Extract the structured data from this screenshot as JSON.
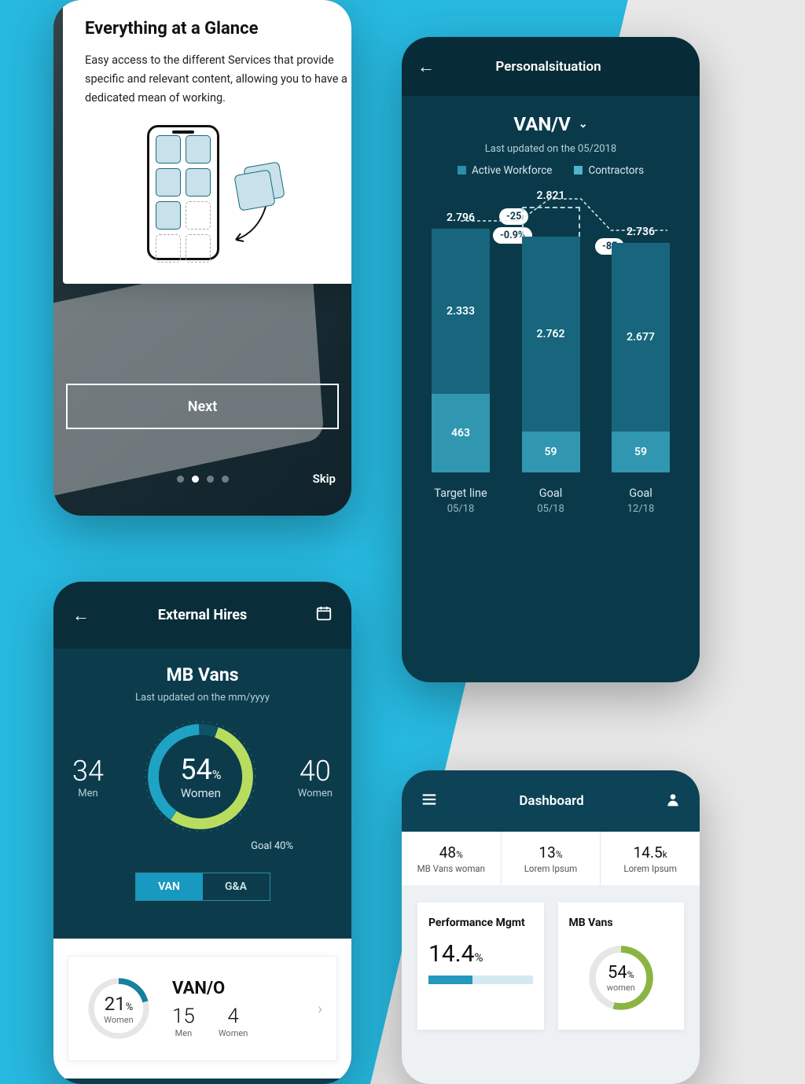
{
  "onboarding": {
    "title": "Everything at a Glance",
    "body": "Easy access to the different Services that provide specific and relevant content, allowing you to have a dedicated mean of working.",
    "next": "Next",
    "skip": "Skip",
    "pagination": {
      "total": 4,
      "active": 1
    }
  },
  "personal": {
    "header": "Personalsituation",
    "dropdown": "VAN/V",
    "updated": "Last updated on the 05/2018",
    "legend": {
      "a": "Active Workforce",
      "b": "Contractors"
    },
    "pills": {
      "diff1": "-25",
      "pct1": "-0.9%",
      "diff2": "-85"
    },
    "chart_data": {
      "type": "bar",
      "stacked": true,
      "series_names": [
        "Contractors",
        "Active Workforce"
      ],
      "columns": [
        {
          "label": "Target line",
          "sublabel": "05/18",
          "total": "2.796",
          "contractors": 463,
          "workforce": "2.333",
          "dashed_cap": false
        },
        {
          "label": "Goal",
          "sublabel": "05/18",
          "total": "2.821",
          "contractors": 59,
          "workforce": "2.762",
          "dashed_cap": true
        },
        {
          "label": "Goal",
          "sublabel": "12/18",
          "total": "2.736",
          "contractors": 59,
          "workforce": "2.677",
          "dashed_cap": false
        }
      ]
    }
  },
  "hires": {
    "header": "External Hires",
    "title": "MB Vans",
    "updated": "Last updated on the mm/yyyy",
    "left": {
      "value": "34",
      "label": "Men"
    },
    "right": {
      "value": "40",
      "label": "Women"
    },
    "donut": {
      "value": "54",
      "unit": "%",
      "label": "Women",
      "goal": "Goal 40%"
    },
    "tabs": {
      "a": "VAN",
      "b": "G&A",
      "active": "a"
    },
    "sub": {
      "title": "VAN/O",
      "mini": {
        "value": "21",
        "unit": "%",
        "label": "Women"
      },
      "men": {
        "value": "15",
        "label": "Men"
      },
      "women": {
        "value": "4",
        "label": "Women"
      }
    }
  },
  "dashboard": {
    "header": "Dashboard",
    "stats": [
      {
        "value": "48",
        "unit": "%",
        "label": "MB Vans woman"
      },
      {
        "value": "13",
        "unit": "%",
        "label": "Lorem Ipsum"
      },
      {
        "value": "14.5",
        "unit": "k",
        "label": "Lorem Ipsum"
      }
    ],
    "cards": {
      "perf": {
        "title": "Performance Mgmt",
        "value": "14.4",
        "unit": "%",
        "progress_pct": 42
      },
      "vans": {
        "title": "MB Vans",
        "value": "54",
        "unit": "%",
        "label": "women"
      }
    }
  },
  "chart_data": {
    "type": "bar",
    "stacked": true,
    "title": "Personalsituation — VAN/V",
    "categories": [
      "Target line 05/18",
      "Goal 05/18",
      "Goal 12/18"
    ],
    "series": [
      {
        "name": "Active Workforce",
        "values": [
          2333,
          2762,
          2677
        ]
      },
      {
        "name": "Contractors",
        "values": [
          463,
          59,
          59
        ]
      }
    ],
    "totals": [
      2796,
      2821,
      2736
    ],
    "annotations": [
      {
        "between": [
          0,
          1
        ],
        "delta": -25,
        "pct": "-0.9%"
      },
      {
        "between": [
          1,
          2
        ],
        "delta": -85
      }
    ]
  }
}
